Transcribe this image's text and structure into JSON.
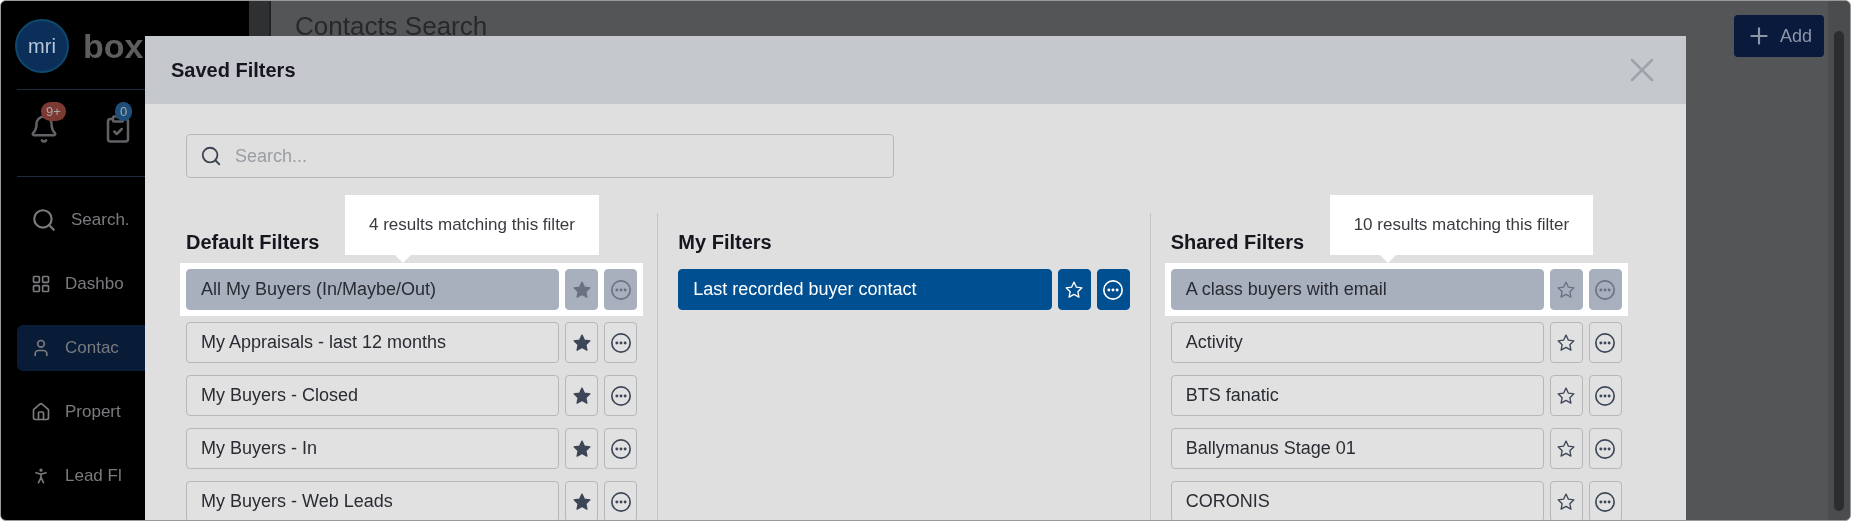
{
  "sidebar": {
    "logo": "mri",
    "brand": "box",
    "notifications_badge": "9+",
    "tasks_badge": "0",
    "items": [
      {
        "label": "Search.",
        "kind": "search",
        "selected": false
      },
      {
        "label": "Dashbo",
        "kind": "grid",
        "selected": false
      },
      {
        "label": "Contac",
        "kind": "user",
        "selected": true
      },
      {
        "label": "Propert",
        "kind": "home",
        "selected": false
      },
      {
        "label": "Lead Fl",
        "kind": "lead",
        "selected": false
      }
    ]
  },
  "page": {
    "title": "Contacts Search",
    "add_button": "Add"
  },
  "modal": {
    "title": "Saved Filters",
    "search": {
      "placeholder": "Search..."
    },
    "columns": [
      {
        "heading": "Default Filters",
        "filters": [
          {
            "name": "All My Buyers (In/Maybe/Out)",
            "starred": true,
            "selected": false,
            "tooltip": "4 results matching this filter"
          },
          {
            "name": "My Appraisals - last 12 months",
            "starred": true,
            "selected": false
          },
          {
            "name": "My Buyers - Closed",
            "starred": true,
            "selected": false
          },
          {
            "name": "My Buyers - In",
            "starred": true,
            "selected": false
          },
          {
            "name": "My Buyers - Web Leads",
            "starred": true,
            "selected": false
          }
        ]
      },
      {
        "heading": "My Filters",
        "filters": [
          {
            "name": "Last recorded buyer contact",
            "starred": false,
            "selected": true
          }
        ]
      },
      {
        "heading": "Shared Filters",
        "filters": [
          {
            "name": "A class buyers with email",
            "starred": false,
            "selected": false,
            "tooltip": "10 results matching this filter"
          },
          {
            "name": "Activity",
            "starred": false,
            "selected": false
          },
          {
            "name": "BTS fanatic",
            "starred": false,
            "selected": false
          },
          {
            "name": "Ballymanus Stage 01",
            "starred": false,
            "selected": false
          },
          {
            "name": "CORONIS",
            "starred": false,
            "selected": false
          }
        ]
      }
    ]
  }
}
